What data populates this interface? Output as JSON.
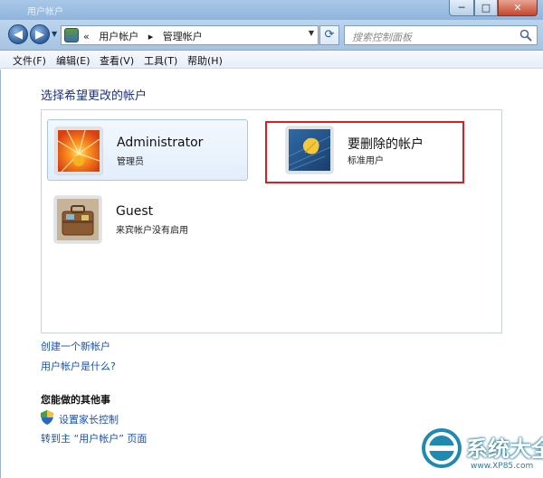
{
  "window": {
    "title": "用户帐户"
  },
  "titlebar": {
    "min_glyph": "─",
    "max_glyph": "□",
    "close_glyph": "✕"
  },
  "nav": {
    "back_glyph": "◀",
    "forward_glyph": "▶",
    "dropdown_glyph": "▼",
    "breadcrumb": {
      "overflow": "«",
      "item1": "用户帐户",
      "sep": "▸",
      "item2": "管理帐户"
    },
    "refresh_glyph": "⟳",
    "search_placeholder": "搜索控制面板"
  },
  "menu": [
    {
      "label": "文件(F)"
    },
    {
      "label": "编辑(E)"
    },
    {
      "label": "查看(V)"
    },
    {
      "label": "工具(T)"
    },
    {
      "label": "帮助(H)"
    }
  ],
  "content": {
    "heading": "选择希望更改的帐户",
    "accounts": [
      {
        "name": "Administrator",
        "type": "管理员",
        "picture": "flower-avatar-icon"
      },
      {
        "name": "要删除的帐户",
        "type": "标准用户",
        "picture": "leaf-avatar-icon"
      },
      {
        "name": "Guest",
        "type": "来宾帐户没有启用",
        "picture": "suitcase-avatar-icon"
      }
    ],
    "links": {
      "create": "创建一个新帐户",
      "what_is": "用户帐户是什么?"
    },
    "other_tasks": {
      "heading": "您能做的其他事",
      "parental": "设置家长控制",
      "goto_main": "转到主 “用户帐户” 页面"
    },
    "highlight_color": "#e01c1c"
  },
  "watermark": {
    "text": "系统大全",
    "url": "www.XP85.com"
  }
}
